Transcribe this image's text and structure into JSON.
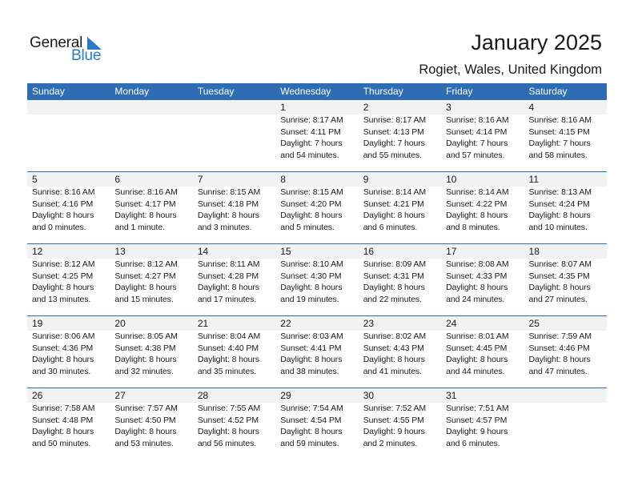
{
  "brand": {
    "word1": "General",
    "word2": "Blue",
    "accent_color": "#2a7bc4"
  },
  "header": {
    "title": "January 2025",
    "location": "Rogiet, Wales, United Kingdom"
  },
  "weekdays": [
    "Sunday",
    "Monday",
    "Tuesday",
    "Wednesday",
    "Thursday",
    "Friday",
    "Saturday"
  ],
  "colors": {
    "header_bg": "#2e6db4",
    "day_strip_bg": "#f2f2f2"
  },
  "weeks": [
    [
      null,
      null,
      null,
      {
        "day": "1",
        "sunrise": "Sunrise: 8:17 AM",
        "sunset": "Sunset: 4:11 PM",
        "daylight1": "Daylight: 7 hours",
        "daylight2": "and 54 minutes."
      },
      {
        "day": "2",
        "sunrise": "Sunrise: 8:17 AM",
        "sunset": "Sunset: 4:13 PM",
        "daylight1": "Daylight: 7 hours",
        "daylight2": "and 55 minutes."
      },
      {
        "day": "3",
        "sunrise": "Sunrise: 8:16 AM",
        "sunset": "Sunset: 4:14 PM",
        "daylight1": "Daylight: 7 hours",
        "daylight2": "and 57 minutes."
      },
      {
        "day": "4",
        "sunrise": "Sunrise: 8:16 AM",
        "sunset": "Sunset: 4:15 PM",
        "daylight1": "Daylight: 7 hours",
        "daylight2": "and 58 minutes."
      }
    ],
    [
      {
        "day": "5",
        "sunrise": "Sunrise: 8:16 AM",
        "sunset": "Sunset: 4:16 PM",
        "daylight1": "Daylight: 8 hours",
        "daylight2": "and 0 minutes."
      },
      {
        "day": "6",
        "sunrise": "Sunrise: 8:16 AM",
        "sunset": "Sunset: 4:17 PM",
        "daylight1": "Daylight: 8 hours",
        "daylight2": "and 1 minute."
      },
      {
        "day": "7",
        "sunrise": "Sunrise: 8:15 AM",
        "sunset": "Sunset: 4:18 PM",
        "daylight1": "Daylight: 8 hours",
        "daylight2": "and 3 minutes."
      },
      {
        "day": "8",
        "sunrise": "Sunrise: 8:15 AM",
        "sunset": "Sunset: 4:20 PM",
        "daylight1": "Daylight: 8 hours",
        "daylight2": "and 5 minutes."
      },
      {
        "day": "9",
        "sunrise": "Sunrise: 8:14 AM",
        "sunset": "Sunset: 4:21 PM",
        "daylight1": "Daylight: 8 hours",
        "daylight2": "and 6 minutes."
      },
      {
        "day": "10",
        "sunrise": "Sunrise: 8:14 AM",
        "sunset": "Sunset: 4:22 PM",
        "daylight1": "Daylight: 8 hours",
        "daylight2": "and 8 minutes."
      },
      {
        "day": "11",
        "sunrise": "Sunrise: 8:13 AM",
        "sunset": "Sunset: 4:24 PM",
        "daylight1": "Daylight: 8 hours",
        "daylight2": "and 10 minutes."
      }
    ],
    [
      {
        "day": "12",
        "sunrise": "Sunrise: 8:12 AM",
        "sunset": "Sunset: 4:25 PM",
        "daylight1": "Daylight: 8 hours",
        "daylight2": "and 13 minutes."
      },
      {
        "day": "13",
        "sunrise": "Sunrise: 8:12 AM",
        "sunset": "Sunset: 4:27 PM",
        "daylight1": "Daylight: 8 hours",
        "daylight2": "and 15 minutes."
      },
      {
        "day": "14",
        "sunrise": "Sunrise: 8:11 AM",
        "sunset": "Sunset: 4:28 PM",
        "daylight1": "Daylight: 8 hours",
        "daylight2": "and 17 minutes."
      },
      {
        "day": "15",
        "sunrise": "Sunrise: 8:10 AM",
        "sunset": "Sunset: 4:30 PM",
        "daylight1": "Daylight: 8 hours",
        "daylight2": "and 19 minutes."
      },
      {
        "day": "16",
        "sunrise": "Sunrise: 8:09 AM",
        "sunset": "Sunset: 4:31 PM",
        "daylight1": "Daylight: 8 hours",
        "daylight2": "and 22 minutes."
      },
      {
        "day": "17",
        "sunrise": "Sunrise: 8:08 AM",
        "sunset": "Sunset: 4:33 PM",
        "daylight1": "Daylight: 8 hours",
        "daylight2": "and 24 minutes."
      },
      {
        "day": "18",
        "sunrise": "Sunrise: 8:07 AM",
        "sunset": "Sunset: 4:35 PM",
        "daylight1": "Daylight: 8 hours",
        "daylight2": "and 27 minutes."
      }
    ],
    [
      {
        "day": "19",
        "sunrise": "Sunrise: 8:06 AM",
        "sunset": "Sunset: 4:36 PM",
        "daylight1": "Daylight: 8 hours",
        "daylight2": "and 30 minutes."
      },
      {
        "day": "20",
        "sunrise": "Sunrise: 8:05 AM",
        "sunset": "Sunset: 4:38 PM",
        "daylight1": "Daylight: 8 hours",
        "daylight2": "and 32 minutes."
      },
      {
        "day": "21",
        "sunrise": "Sunrise: 8:04 AM",
        "sunset": "Sunset: 4:40 PM",
        "daylight1": "Daylight: 8 hours",
        "daylight2": "and 35 minutes."
      },
      {
        "day": "22",
        "sunrise": "Sunrise: 8:03 AM",
        "sunset": "Sunset: 4:41 PM",
        "daylight1": "Daylight: 8 hours",
        "daylight2": "and 38 minutes."
      },
      {
        "day": "23",
        "sunrise": "Sunrise: 8:02 AM",
        "sunset": "Sunset: 4:43 PM",
        "daylight1": "Daylight: 8 hours",
        "daylight2": "and 41 minutes."
      },
      {
        "day": "24",
        "sunrise": "Sunrise: 8:01 AM",
        "sunset": "Sunset: 4:45 PM",
        "daylight1": "Daylight: 8 hours",
        "daylight2": "and 44 minutes."
      },
      {
        "day": "25",
        "sunrise": "Sunrise: 7:59 AM",
        "sunset": "Sunset: 4:46 PM",
        "daylight1": "Daylight: 8 hours",
        "daylight2": "and 47 minutes."
      }
    ],
    [
      {
        "day": "26",
        "sunrise": "Sunrise: 7:58 AM",
        "sunset": "Sunset: 4:48 PM",
        "daylight1": "Daylight: 8 hours",
        "daylight2": "and 50 minutes."
      },
      {
        "day": "27",
        "sunrise": "Sunrise: 7:57 AM",
        "sunset": "Sunset: 4:50 PM",
        "daylight1": "Daylight: 8 hours",
        "daylight2": "and 53 minutes."
      },
      {
        "day": "28",
        "sunrise": "Sunrise: 7:55 AM",
        "sunset": "Sunset: 4:52 PM",
        "daylight1": "Daylight: 8 hours",
        "daylight2": "and 56 minutes."
      },
      {
        "day": "29",
        "sunrise": "Sunrise: 7:54 AM",
        "sunset": "Sunset: 4:54 PM",
        "daylight1": "Daylight: 8 hours",
        "daylight2": "and 59 minutes."
      },
      {
        "day": "30",
        "sunrise": "Sunrise: 7:52 AM",
        "sunset": "Sunset: 4:55 PM",
        "daylight1": "Daylight: 9 hours",
        "daylight2": "and 2 minutes."
      },
      {
        "day": "31",
        "sunrise": "Sunrise: 7:51 AM",
        "sunset": "Sunset: 4:57 PM",
        "daylight1": "Daylight: 9 hours",
        "daylight2": "and 6 minutes."
      },
      null
    ]
  ]
}
